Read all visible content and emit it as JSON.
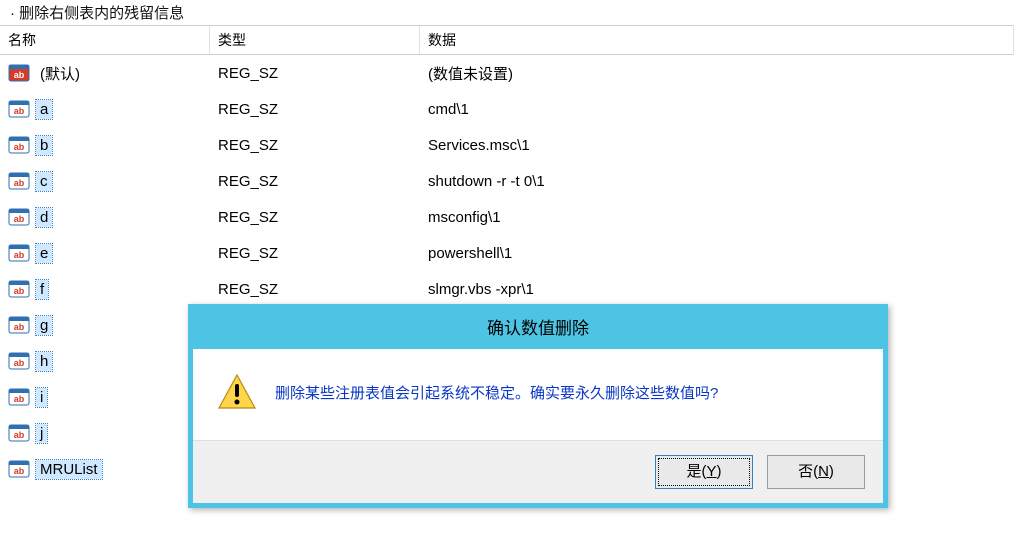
{
  "top_note": "· 删除右侧表内的残留信息",
  "headers": {
    "name": "名称",
    "type": "类型",
    "data": "数据"
  },
  "rows": [
    {
      "name": "(默认)",
      "type": "REG_SZ",
      "data": "(数值未设置)",
      "selected": false,
      "icon_variant": "red"
    },
    {
      "name": "a",
      "type": "REG_SZ",
      "data": "cmd\\1",
      "selected": true,
      "icon_variant": "blue"
    },
    {
      "name": "b",
      "type": "REG_SZ",
      "data": "Services.msc\\1",
      "selected": true,
      "icon_variant": "blue"
    },
    {
      "name": "c",
      "type": "REG_SZ",
      "data": "shutdown -r -t 0\\1",
      "selected": true,
      "icon_variant": "blue"
    },
    {
      "name": "d",
      "type": "REG_SZ",
      "data": "msconfig\\1",
      "selected": true,
      "icon_variant": "blue"
    },
    {
      "name": "e",
      "type": "REG_SZ",
      "data": "powershell\\1",
      "selected": true,
      "icon_variant": "blue"
    },
    {
      "name": "f",
      "type": "REG_SZ",
      "data": "slmgr.vbs -xpr\\1",
      "selected": true,
      "icon_variant": "blue"
    },
    {
      "name": "g",
      "type": "",
      "data": "",
      "selected": true,
      "icon_variant": "blue"
    },
    {
      "name": "h",
      "type": "",
      "data": "",
      "selected": true,
      "icon_variant": "blue"
    },
    {
      "name": "i",
      "type": "",
      "data": "",
      "selected": true,
      "icon_variant": "blue"
    },
    {
      "name": "j",
      "type": "",
      "data": "",
      "selected": true,
      "icon_variant": "blue"
    },
    {
      "name": "MRUList",
      "type": "",
      "data": "",
      "selected": true,
      "icon_variant": "blue"
    }
  ],
  "dialog": {
    "title": "确认数值删除",
    "message": "删除某些注册表值会引起系统不稳定。确实要永久删除这些数值吗?",
    "yes_label": "是",
    "yes_mnemonic": "Y",
    "no_label": "否",
    "no_mnemonic": "N"
  },
  "colors": {
    "dialog_border": "#4ec4e4",
    "dialog_msg": "#0a36c6",
    "selection_bg": "#cde8ff"
  }
}
